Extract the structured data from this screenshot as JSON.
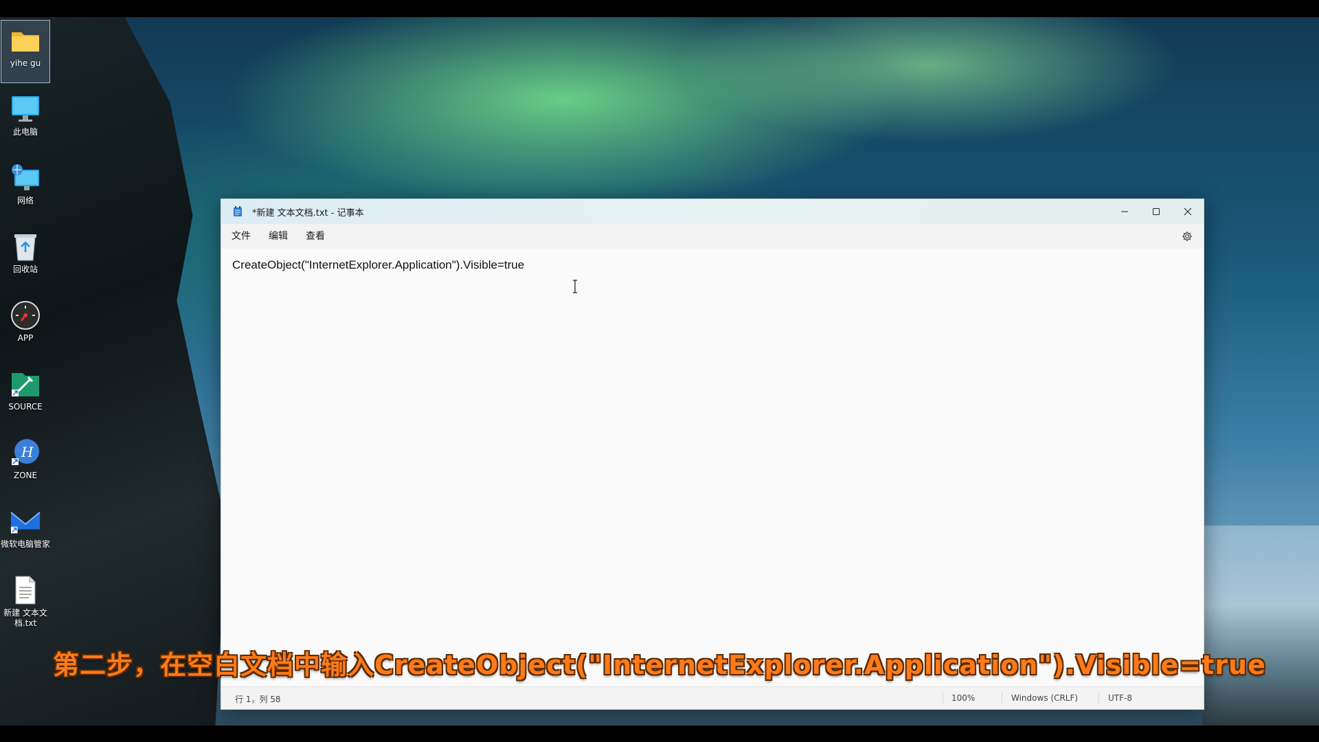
{
  "desktop": {
    "icons": [
      {
        "label": "yihe gu",
        "icon": "folder-icon"
      },
      {
        "label": "此电脑",
        "icon": "computer-icon"
      },
      {
        "label": "网络",
        "icon": "network-icon"
      },
      {
        "label": "回收站",
        "icon": "recycle-bin-icon"
      },
      {
        "label": "APP",
        "icon": "app-icon"
      },
      {
        "label": "SOURCE",
        "icon": "source-icon"
      },
      {
        "label": "ZONE",
        "icon": "zone-icon"
      },
      {
        "label": "微软电脑管家",
        "icon": "pc-manager-icon"
      },
      {
        "label": "新建 文本文档.txt",
        "icon": "text-file-icon"
      }
    ]
  },
  "window": {
    "title": "*新建 文本文档.txt - 记事本",
    "menu": [
      "文件",
      "编辑",
      "查看"
    ],
    "editor_text": "CreateObject(\"InternetExplorer.Application\").Visible=true",
    "status": {
      "position": "行 1，列 58",
      "zoom": "100%",
      "line_ending": "Windows (CRLF)",
      "encoding": "UTF-8"
    }
  },
  "caption": "第二步，在空白文档中输入CreateObject(\"InternetExplorer.Application\").Visible=true",
  "colors": {
    "caption": "#ff7a1a",
    "accent": "#0067c0"
  }
}
